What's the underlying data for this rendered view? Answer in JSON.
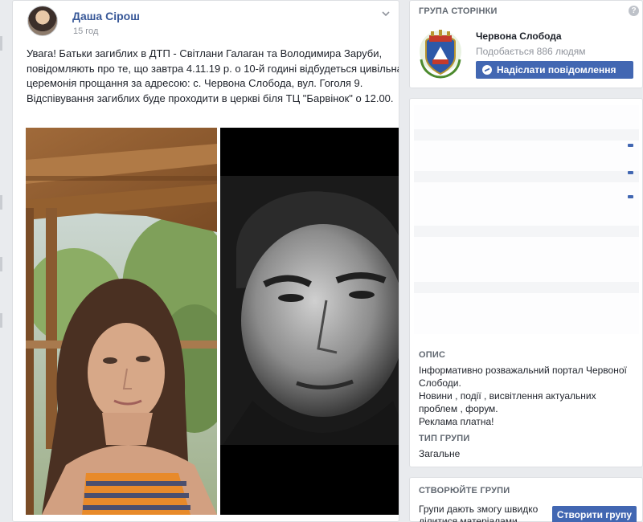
{
  "post": {
    "author": "Даша Сірош",
    "timestamp": "15 год",
    "text": "Увага! Батьки загиблих в ДТП - Світлани Галаган та Володимира Заруби, повідомляють про те, що завтра 4.11.19 р. о 10-й годині відбудеться цивільна церемонія прощання за адресою: с. Червона Слобода, вул. Гоголя 9. Відспівування загиблих буде проходити в церкві біля ТЦ \"Барвінок\" о 12.00."
  },
  "sidebar": {
    "group_page_heading": "ГРУПА СТОРІНКИ",
    "page_name": "Червона Слобода",
    "page_likes": "Подобається 886 людям",
    "message_button": "Надіслати повідомлення",
    "description_heading": "ОПИС",
    "description_lines": [
      "Інформативно розважальний портал Червоної",
      "Слободи.",
      "Новини , події , висвітлення актуальних",
      "проблем , форум.",
      "Реклама платна!"
    ],
    "group_type_heading": "ТИП ГРУПИ",
    "group_type": "Загальне",
    "create_heading": "СТВОРЮЙТЕ ГРУПИ",
    "create_text": "Групи дають змогу швидко ділитися матеріалами",
    "create_button": "Створити групу"
  },
  "colors": {
    "accent": "#4267b2",
    "link": "#385898",
    "background": "#e9ebee"
  }
}
